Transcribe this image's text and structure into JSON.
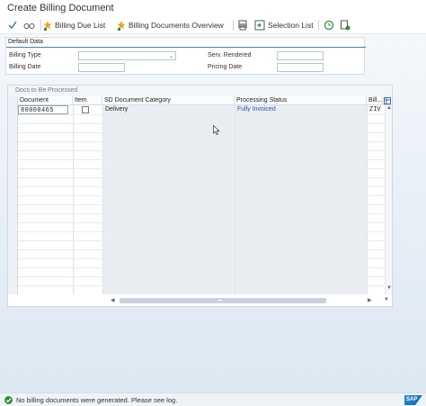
{
  "window": {
    "title": "Create Billing Document"
  },
  "toolbar": {
    "billing_due_list": "Billing Due List",
    "billing_documents_overview": "Billing Documents Overview",
    "selection_list": "Selection List"
  },
  "default_data": {
    "header": "Default Data",
    "billing_type_label": "Billing Type",
    "billing_type_value": "",
    "billing_date_label": "Billing Date",
    "billing_date_value": "",
    "serv_rendered_label": "Serv. Rendered",
    "serv_rendered_value": "",
    "pricing_date_label": "Pricing Date",
    "pricing_date_value": ""
  },
  "docs_panel": {
    "title": "Docs to Be Processed",
    "columns": [
      "Document",
      "Item",
      "SD Document Category",
      "Processing Status",
      "Bill..."
    ],
    "rows": [
      {
        "document": "80000465",
        "item": "",
        "category": "Delivery",
        "status": "Fully Invoiced",
        "billing": "ZIV"
      }
    ]
  },
  "status_bar": {
    "message": "No billing documents were generated. Please see log.",
    "type": "success",
    "logo_text": "SAP"
  },
  "colors": {
    "accent": "#4a7fb5",
    "link": "#2456a6",
    "status_ok": "#2f8f3a"
  }
}
